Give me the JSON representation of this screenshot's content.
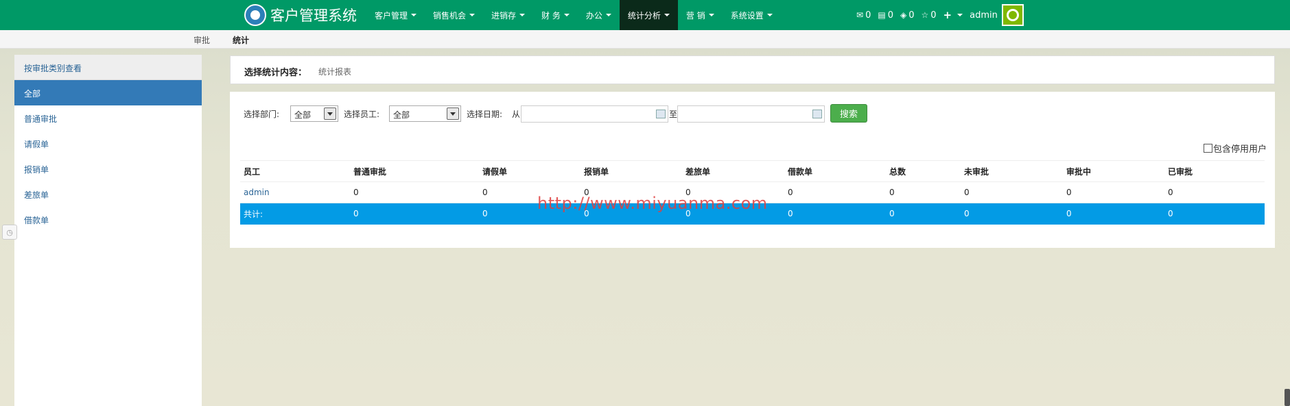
{
  "app": {
    "title": "客户管理系统"
  },
  "nav": {
    "items": [
      {
        "label": "客户管理",
        "active": false
      },
      {
        "label": "销售机会",
        "active": false
      },
      {
        "label": "进销存",
        "active": false
      },
      {
        "label": "财 务",
        "active": false
      },
      {
        "label": "办公",
        "active": false
      },
      {
        "label": "统计分析",
        "active": true
      },
      {
        "label": "营 销",
        "active": false
      },
      {
        "label": "系统设置",
        "active": false
      }
    ],
    "right": {
      "mail_count": "0",
      "list_count": "0",
      "task_count": "0",
      "star_count": "0",
      "user": "admin"
    }
  },
  "subnav": {
    "approve": "审批",
    "stats": "统计"
  },
  "sidebar": {
    "header": "按审批类别查看",
    "items": [
      {
        "label": "全部",
        "active": true
      },
      {
        "label": "普通审批",
        "active": false
      },
      {
        "label": "请假单",
        "active": false
      },
      {
        "label": "报销单",
        "active": false
      },
      {
        "label": "差旅单",
        "active": false
      },
      {
        "label": "借款单",
        "active": false
      }
    ]
  },
  "content_select": {
    "label": "选择统计内容：",
    "value": "统计报表"
  },
  "filters": {
    "dept_label": "选择部门:",
    "dept_value": "全部",
    "emp_label": "选择员工:",
    "emp_value": "全部",
    "date_label": "选择日期:",
    "from_label": "从",
    "to_label": "至",
    "from_value": "",
    "to_value": "",
    "search_label": "搜索",
    "include_disabled_label": "包含停用用户"
  },
  "table": {
    "headers": [
      "员工",
      "普通审批",
      "请假单",
      "报销单",
      "差旅单",
      "借款单",
      "总数",
      "未审批",
      "审批中",
      "已审批"
    ],
    "rows": [
      [
        "admin",
        "0",
        "0",
        "0",
        "0",
        "0",
        "0",
        "0",
        "0",
        "0"
      ]
    ],
    "total": [
      "共计:",
      "0",
      "0",
      "0",
      "0",
      "0",
      "0",
      "0",
      "0",
      "0"
    ]
  },
  "watermark": "http://www.miyuanma.com",
  "colors": {
    "navbar": "#009966",
    "active_nav": "#0b2a1a",
    "sidebar_active": "#337ab7",
    "total_row": "#039be5",
    "search_button": "#4cae4c"
  }
}
